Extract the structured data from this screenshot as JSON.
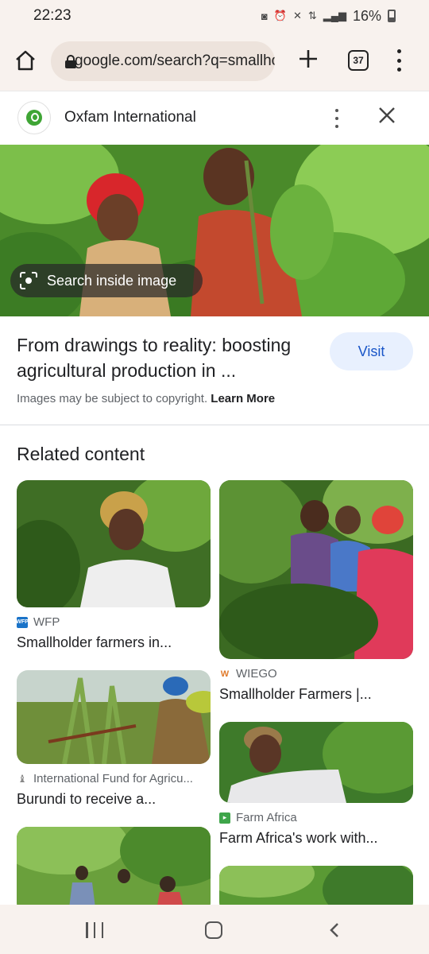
{
  "status": {
    "time": "22:23",
    "battery": "16%"
  },
  "browser": {
    "url": "google.com/search?q=smallholder",
    "tab_count": "37"
  },
  "source": {
    "name": "Oxfam International",
    "logo_color": "#3fa535"
  },
  "hero": {
    "search_inside_label": "Search inside image"
  },
  "result": {
    "title": "From drawings to reality: boosting agricultural production in ...",
    "visit_label": "Visit",
    "copyright_text": "Images may be subject to copyright.",
    "learn_more_label": "Learn More"
  },
  "related": {
    "heading": "Related content",
    "cards": [
      {
        "source": "WFP",
        "title": "Smallholder farmers in...",
        "favicon": "wfp-icon",
        "favicon_label": "WFP"
      },
      {
        "source": "WIEGO",
        "title": "Smallholder Farmers |...",
        "favicon": "wiego-icon",
        "favicon_label": "W"
      },
      {
        "source": "International Fund for Agricu...",
        "title": "Burundi to receive a...",
        "favicon": "ifad-icon",
        "favicon_label": "♝"
      },
      {
        "source": "Farm Africa",
        "title": "Farm Africa's work with...",
        "favicon": "farm-africa-icon",
        "favicon_label": "▸"
      }
    ]
  },
  "colors": {
    "accent": "#1a56c8",
    "visit_bg": "#e8f0fe",
    "chrome_bg": "#f8f2ee"
  }
}
